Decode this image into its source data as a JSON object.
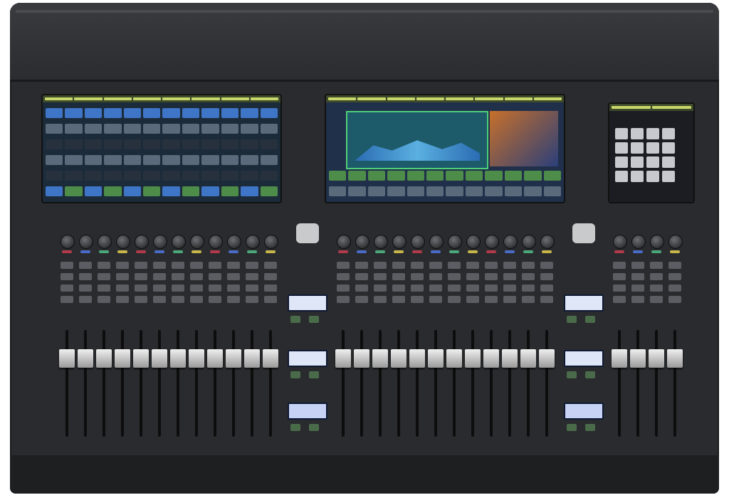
{
  "device": {
    "type": "digital-mixing-console",
    "screens": 3,
    "accent_colors": {
      "screen_topbar": "#c8d66a",
      "selected_blue": "#3f75c6",
      "selected_green": "#4e8c4a",
      "panel_outline": "#4fcf7a",
      "knob_ring_red": "#b33a4a",
      "knob_ring_blue": "#4a6bc7",
      "knob_ring_green": "#4aa87a",
      "knob_ring_yellow": "#c7b64a"
    }
  },
  "banks": {
    "left_strips": 12,
    "middle_strips": 12,
    "right_strips": 4
  },
  "faders": {
    "left_levels": [
      0.78,
      0.78,
      0.78,
      0.78,
      0.78,
      0.78,
      0.78,
      0.78,
      0.78,
      0.78,
      0.78,
      0.78
    ],
    "middle_levels": [
      0.78,
      0.78,
      0.78,
      0.78,
      0.78,
      0.78,
      0.78,
      0.78,
      0.78,
      0.78,
      0.78,
      0.78
    ],
    "right_levels": [
      0.78,
      0.78,
      0.78,
      0.78
    ]
  },
  "icons": {
    "logo_left": "brand-logo-icon",
    "logo_right": "brand-logo-icon"
  }
}
